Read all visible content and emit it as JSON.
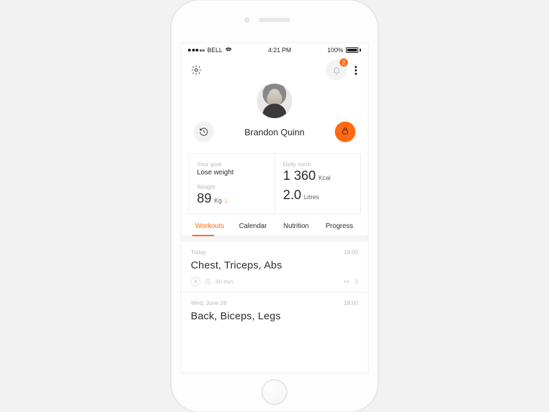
{
  "statusbar": {
    "carrier": "BELL",
    "time": "4:21 PM",
    "battery": "100%"
  },
  "notifications": {
    "count": "2"
  },
  "profile": {
    "name": "Brandon Quinn"
  },
  "stats": {
    "goal_label": "Your goal",
    "goal_value": "Lose weight",
    "weight_label": "Weight",
    "weight_value": "89",
    "weight_unit": "Kg",
    "norm_label": "Daily norm",
    "kcal_value": "1 360",
    "kcal_unit": "Kcal",
    "litres_value": "2.0",
    "litres_unit": "Litres"
  },
  "tabs": {
    "workouts": "Workouts",
    "calendar": "Calendar",
    "nutrition": "Nutrition",
    "progress": "Progress"
  },
  "workouts": [
    {
      "day": "Today",
      "time": "18:00",
      "title": "Chest, Triceps, Abs",
      "level": "A",
      "duration": "80 min",
      "weight_count": "5"
    },
    {
      "day": "Wed, June 26",
      "time": "18:00",
      "title": "Back, Biceps, Legs"
    }
  ],
  "colors": {
    "accent": "#ff6a13"
  }
}
